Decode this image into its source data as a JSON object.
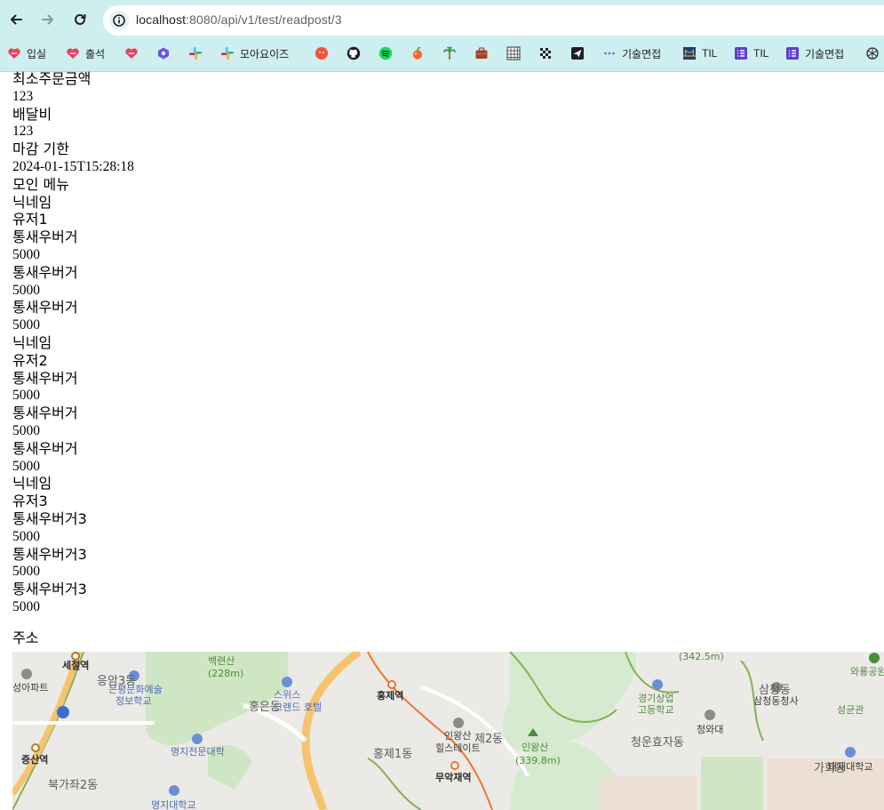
{
  "browser": {
    "url_host": "localhost",
    "url_rest": ":8080/api/v1/test/readpost/3",
    "bookmarks": [
      {
        "label": "입실",
        "icon": "heart-chat-icon"
      },
      {
        "label": "출석",
        "icon": "heart-chat-icon"
      },
      {
        "label": "",
        "icon": "heart-chat-icon"
      },
      {
        "label": "",
        "icon": "hexagon-icon"
      },
      {
        "label": "",
        "icon": "slack-icon"
      },
      {
        "label": "모아요이즈",
        "icon": "slack-icon"
      },
      {
        "label": "",
        "icon": "tomato-icon"
      },
      {
        "label": "",
        "icon": "github-icon"
      },
      {
        "label": "",
        "icon": "spotify-icon"
      },
      {
        "label": "",
        "icon": "fruit-icon"
      },
      {
        "label": "",
        "icon": "palm-tree-icon"
      },
      {
        "label": "",
        "icon": "briefcase-icon"
      },
      {
        "label": "",
        "icon": "grid-icon"
      },
      {
        "label": "",
        "icon": "checkered-flag-icon"
      },
      {
        "label": "",
        "icon": "paper-plane-icon"
      },
      {
        "label": "기술면접",
        "icon": "dots-icon"
      },
      {
        "label": "TIL",
        "icon": "bridge-icon"
      },
      {
        "label": "TIL",
        "icon": "list-doc-icon"
      },
      {
        "label": "기술면접",
        "icon": "list-doc-icon"
      },
      {
        "label": "",
        "icon": "openai-icon"
      }
    ]
  },
  "post": {
    "min_order_label": "최소주문금액",
    "min_order_value": "123",
    "delivery_fee_label": "배달비",
    "delivery_fee_value": "123",
    "deadline_label": "마감 기한",
    "deadline_value": "2024-01-15T15:28:18",
    "menu_section_label": "모인 메뉴",
    "orders": [
      {
        "nickname_label": "닉네임",
        "nickname": "유저1",
        "items": [
          {
            "name": "통새우버거",
            "price": "5000"
          },
          {
            "name": "통새우버거",
            "price": "5000"
          },
          {
            "name": "통새우버거",
            "price": "5000"
          }
        ]
      },
      {
        "nickname_label": "닉네임",
        "nickname": "유저2",
        "items": [
          {
            "name": "통새우버거",
            "price": "5000"
          },
          {
            "name": "통새우버거",
            "price": "5000"
          },
          {
            "name": "통새우버거",
            "price": "5000"
          }
        ]
      },
      {
        "nickname_label": "닉네임",
        "nickname": "유저3",
        "items": [
          {
            "name": "통새우버거3",
            "price": "5000"
          },
          {
            "name": "통새우버거3",
            "price": "5000"
          },
          {
            "name": "통새우버거3",
            "price": "5000"
          }
        ]
      }
    ],
    "address_label": "주소"
  },
  "map": {
    "labels": [
      "(342.5m)",
      "와룡공원",
      "백련산",
      "(228m)",
      "세절역",
      "성아파트",
      "응암3동",
      "은평문화예술",
      "정보학교",
      "스위스",
      "홍은동",
      "그랜드 호텔",
      "홍제역",
      "경기상업",
      "고등학교",
      "삼청동",
      "삼청동청사",
      "성균관",
      "청와대",
      "인왕산",
      "힐스테이트",
      "제2동",
      "인왕산",
      "(339.8m)",
      "청운효자동",
      "명지전문대학",
      "홍제1동",
      "증산역",
      "무악재역",
      "가회동",
      "태재대학교",
      "북가좌2동",
      "명지대학교"
    ],
    "colors": {
      "land": "#eceae6",
      "park": "#cfe6c4",
      "road_major": "#f6c36e",
      "river": "#82b34f",
      "rail": "#f0742e"
    }
  }
}
